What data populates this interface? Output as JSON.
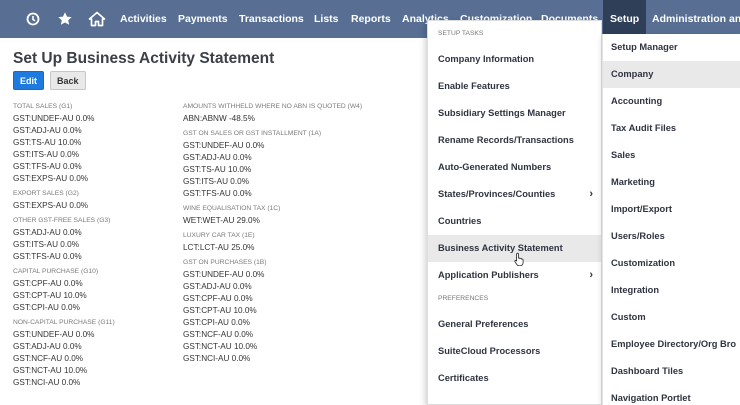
{
  "nav": {
    "items": [
      "Activities",
      "Payments",
      "Transactions",
      "Lists",
      "Reports",
      "Analytics",
      "Customization",
      "Documents",
      "Setup",
      "Administration and"
    ]
  },
  "page": {
    "title": "Set Up Business Activity Statement",
    "edit_label": "Edit",
    "back_label": "Back"
  },
  "left_groups": [
    {
      "title": "TOTAL SALES (G1)",
      "lines": [
        "GST:UNDEF-AU 0.0%",
        "GST:ADJ-AU 0.0%",
        "GST:TS-AU 10.0%",
        "GST:ITS-AU 0.0%",
        "GST:TFS-AU 0.0%",
        "GST:EXPS-AU 0.0%"
      ]
    },
    {
      "title": "EXPORT SALES (G2)",
      "lines": [
        "GST:EXPS-AU 0.0%"
      ]
    },
    {
      "title": "OTHER GST-FREE SALES (G3)",
      "lines": [
        "GST:ADJ-AU 0.0%",
        "GST:ITS-AU 0.0%",
        "GST:TFS-AU 0.0%"
      ]
    },
    {
      "title": "CAPITAL PURCHASE (G10)",
      "lines": [
        "GST:CPF-AU 0.0%",
        "GST:CPT-AU 10.0%",
        "GST:CPI-AU 0.0%"
      ]
    },
    {
      "title": "NON-CAPITAL PURCHASE (G11)",
      "lines": [
        "GST:UNDEF-AU 0.0%",
        "GST:ADJ-AU 0.0%",
        "GST:NCF-AU 0.0%",
        "GST:NCT-AU 10.0%",
        "GST:NCI-AU 0.0%"
      ]
    }
  ],
  "right_groups": [
    {
      "title": "AMOUNTS WITHHELD WHERE NO ABN IS QUOTED (W4)",
      "lines": [
        "ABN:ABNW -48.5%"
      ]
    },
    {
      "title": "GST ON SALES OR GST INSTALLMENT (1A)",
      "lines": [
        "GST:UNDEF-AU 0.0%",
        "GST:ADJ-AU 0.0%",
        "GST:TS-AU 10.0%",
        "GST:ITS-AU 0.0%",
        "GST:TFS-AU 0.0%"
      ]
    },
    {
      "title": "WINE EQUALISATION TAX (1C)",
      "lines": [
        "WET:WET-AU 29.0%"
      ]
    },
    {
      "title": "LUXURY CAR TAX (1E)",
      "lines": [
        "LCT:LCT-AU 25.0%"
      ]
    },
    {
      "title": "GST ON PURCHASES (1B)",
      "lines": [
        "GST:UNDEF-AU 0.0%",
        "GST:ADJ-AU 0.0%",
        "GST:CPF-AU 0.0%",
        "GST:CPT-AU 10.0%",
        "GST:CPI-AU 0.0%",
        "GST:NCF-AU 0.0%",
        "GST:NCT-AU 10.0%",
        "GST:NCI-AU 0.0%"
      ]
    }
  ],
  "setup_menu": {
    "section_tasks": "SETUP TASKS",
    "tasks": [
      {
        "label": "Company Information",
        "arrow": ""
      },
      {
        "label": "Enable Features",
        "arrow": ""
      },
      {
        "label": "Subsidiary Settings Manager",
        "arrow": ""
      },
      {
        "label": "Rename Records/Transactions",
        "arrow": ""
      },
      {
        "label": "Auto-Generated Numbers",
        "arrow": ""
      },
      {
        "label": "States/Provinces/Counties",
        "arrow": "›"
      },
      {
        "label": "Countries",
        "arrow": ""
      },
      {
        "label": "Business Activity Statement",
        "arrow": ""
      },
      {
        "label": "Application Publishers",
        "arrow": "›"
      }
    ],
    "section_prefs": "PREFERENCES",
    "prefs": [
      "General Preferences",
      "SuiteCloud Processors",
      "Certificates"
    ]
  },
  "setup_submenu": {
    "items": [
      "Setup Manager",
      "Company",
      "Accounting",
      "Tax Audit Files",
      "Sales",
      "Marketing",
      "Import/Export",
      "Users/Roles",
      "Customization",
      "Integration",
      "Custom",
      "Employee Directory/Org Bro",
      "Dashboard Tiles",
      "Navigation Portlet"
    ]
  }
}
